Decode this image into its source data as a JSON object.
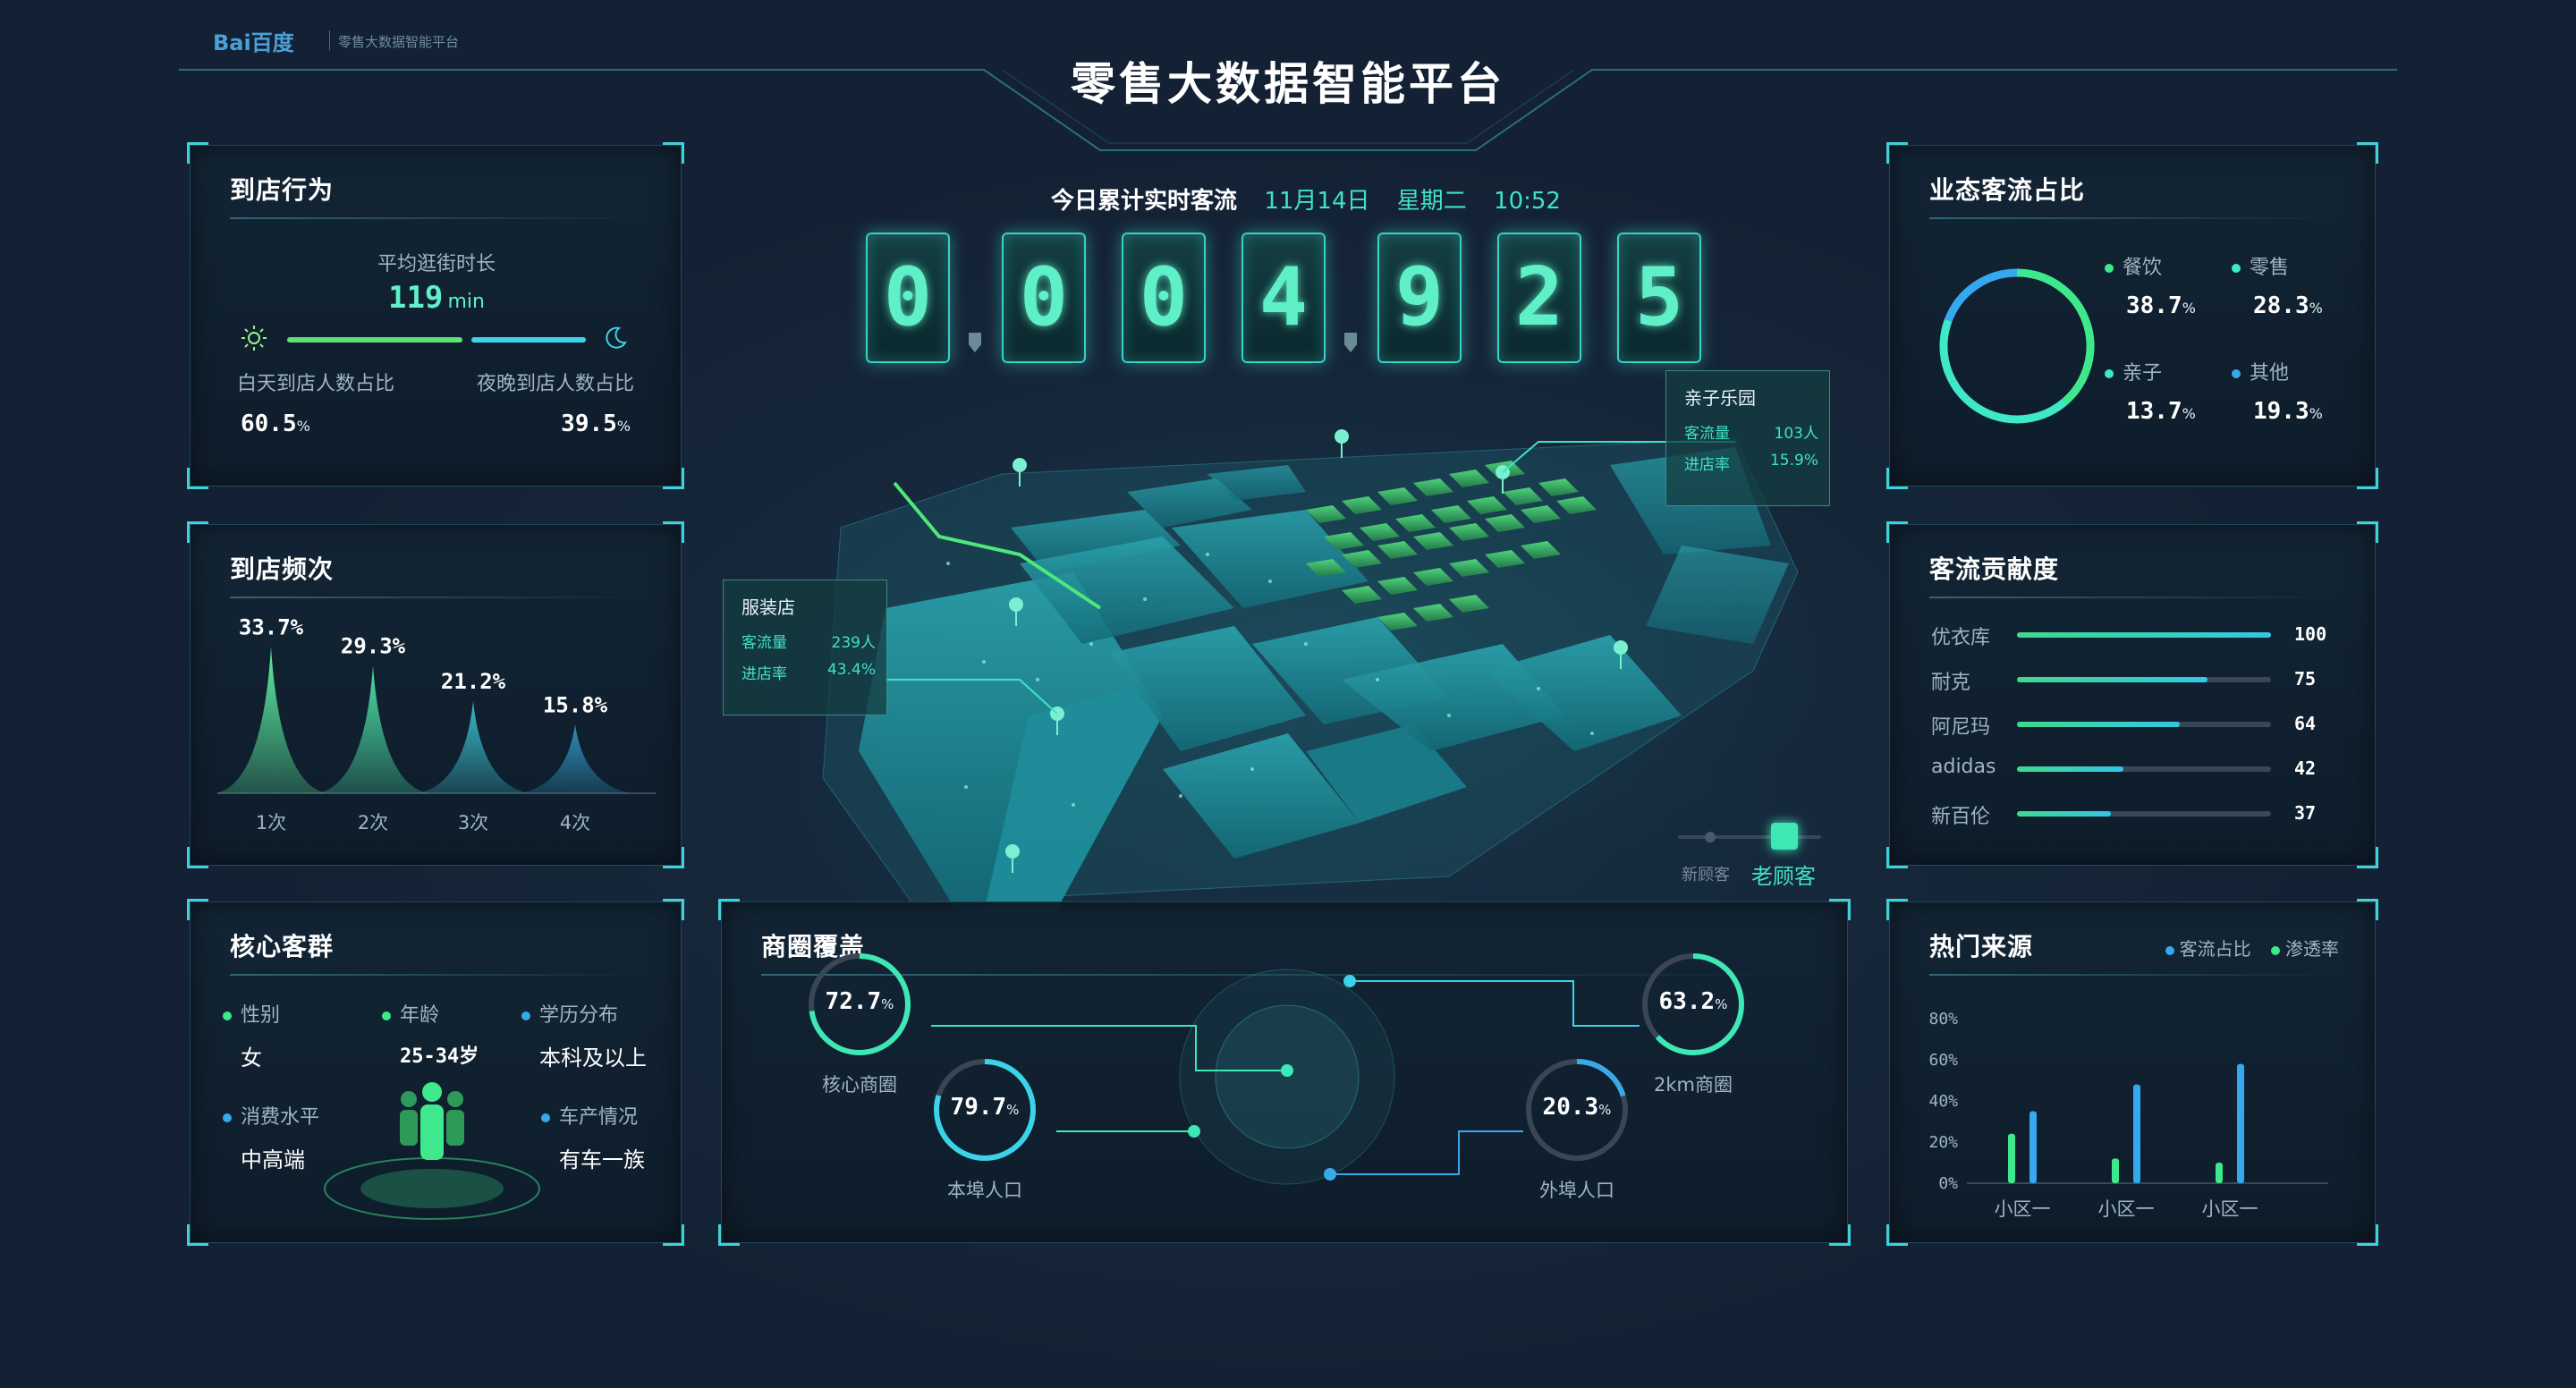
{
  "header": {
    "logo_text": "Bai百度",
    "subtitle": "零售大数据智能平台",
    "title": "零售大数据智能平台"
  },
  "counter": {
    "label": "今日累计实时客流",
    "date": "11月14日",
    "weekday": "星期二",
    "time": "10:52",
    "digits": [
      "0",
      "0",
      "0",
      "4",
      "9",
      "2",
      "5"
    ]
  },
  "behavior": {
    "title": "到店行为",
    "avg_label": "平均逛街时长",
    "avg_value": "119",
    "avg_unit": "min",
    "day_label": "白天到店人数占比",
    "night_label": "夜晚到店人数占比",
    "day_value": "60.5",
    "night_value": "39.5",
    "pct": "%",
    "day_ratio": 0.605
  },
  "frequency": {
    "title": "到店频次",
    "chart_data": {
      "type": "area",
      "categories": [
        "1次",
        "2次",
        "3次",
        "4次"
      ],
      "values": [
        33.7,
        29.3,
        21.2,
        15.8
      ],
      "value_labels": [
        "33.7",
        "29.3",
        "21.2",
        "15.8"
      ],
      "colors": [
        "#5ef0a0",
        "#4de0a6",
        "#3ab8c8",
        "#2f8fb8"
      ]
    }
  },
  "core": {
    "title": "核心客群",
    "items": [
      {
        "label": "性别",
        "value": "女"
      },
      {
        "label": "年龄",
        "value": "25-34岁"
      },
      {
        "label": "学历分布",
        "value": "本科及以上"
      },
      {
        "label": "消费水平",
        "value": "中高端"
      },
      {
        "label": "车产情况",
        "value": "有车一族"
      }
    ]
  },
  "map": {
    "callouts": [
      {
        "title": "亲子乐园",
        "rows": [
          {
            "k": "客流量",
            "v": "103人"
          },
          {
            "k": "进店率",
            "v": "15.9%"
          }
        ]
      },
      {
        "title": "服装店",
        "rows": [
          {
            "k": "客流量",
            "v": "239人"
          },
          {
            "k": "进店率",
            "v": "43.4%"
          }
        ]
      }
    ],
    "toggle_new": "新顾客",
    "toggle_old": "老顾客"
  },
  "coverage": {
    "title": "商圈覆盖",
    "rings": [
      {
        "label": "核心商圈",
        "value": "72.7",
        "ratio": 0.727,
        "color": "#3ee8b4"
      },
      {
        "label": "本埠人口",
        "value": "79.7",
        "ratio": 0.797,
        "color": "#3ad3e8"
      },
      {
        "label": "2km商圈",
        "value": "63.2",
        "ratio": 0.632,
        "color": "#3ee8b4"
      },
      {
        "label": "外埠人口",
        "value": "20.3",
        "ratio": 0.203,
        "color": "#3aa9e8"
      }
    ]
  },
  "format": {
    "title": "业态客流占比",
    "items": [
      {
        "label": "餐饮",
        "value": "38.7",
        "color": "#3ee88c"
      },
      {
        "label": "零售",
        "value": "28.3",
        "color": "#3ee8c8"
      },
      {
        "label": "亲子",
        "value": "13.7",
        "color": "#3ee8c8"
      },
      {
        "label": "其他",
        "value": "19.3",
        "color": "#35a8f0"
      }
    ],
    "chart_data": {
      "type": "pie",
      "categories": [
        "餐饮",
        "零售",
        "亲子",
        "其他"
      ],
      "values": [
        38.7,
        28.3,
        13.7,
        19.3
      ]
    }
  },
  "contribution": {
    "title": "客流贡献度",
    "chart_data": {
      "type": "bar",
      "categories": [
        "优衣库",
        "耐克",
        "阿尼玛",
        "adidas",
        "新百伦"
      ],
      "values": [
        100,
        75,
        64,
        42,
        37
      ],
      "ylim": [
        0,
        100
      ]
    }
  },
  "sources": {
    "title": "热门来源",
    "legend": [
      {
        "label": "客流占比",
        "color": "#35a8f0"
      },
      {
        "label": "渗透率",
        "color": "#3ee88c"
      }
    ],
    "chart_data": {
      "type": "bar",
      "categories": [
        "小区一",
        "小区一",
        "小区一"
      ],
      "series": [
        {
          "name": "渗透率",
          "values": [
            24,
            12,
            10
          ]
        },
        {
          "name": "客流占比",
          "values": [
            35,
            48,
            58
          ]
        }
      ],
      "yticks": [
        "80%",
        "60%",
        "40%",
        "20%",
        "0%"
      ],
      "ylim": [
        0,
        80
      ]
    }
  }
}
